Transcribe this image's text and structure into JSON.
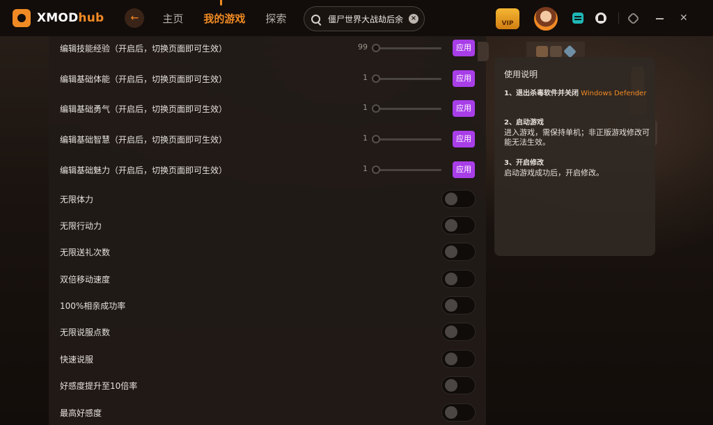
{
  "app": {
    "logo_text": "XMOD",
    "logo_accent": "hub"
  },
  "nav": {
    "items": [
      "主页",
      "我的游戏",
      "探索"
    ],
    "active_index": 1
  },
  "search": {
    "value": "僵尸世界大战劫后余"
  },
  "vip_label": "VIP",
  "sliders": [
    {
      "label": "编辑技能经验（开启后，切换页面即可生效）",
      "value": "99",
      "button": "应用"
    },
    {
      "label": "编辑基础体能（开启后，切换页面即可生效）",
      "value": "1",
      "button": "应用"
    },
    {
      "label": "编辑基础勇气（开启后，切换页面即可生效）",
      "value": "1",
      "button": "应用"
    },
    {
      "label": "编辑基础智慧（开启后，切换页面即可生效）",
      "value": "1",
      "button": "应用"
    },
    {
      "label": "编辑基础魅力（开启后，切换页面即可生效）",
      "value": "1",
      "button": "应用"
    }
  ],
  "toggles": [
    {
      "label": "无限体力",
      "on": false
    },
    {
      "label": "无限行动力",
      "on": false
    },
    {
      "label": "无限送礼次数",
      "on": false
    },
    {
      "label": "双倍移动速度",
      "on": false
    },
    {
      "label": "100%相亲成功率",
      "on": false
    },
    {
      "label": "无限说服点数",
      "on": false
    },
    {
      "label": "快速说服",
      "on": false
    },
    {
      "label": "好感度提升至10倍率",
      "on": false
    },
    {
      "label": "最高好感度",
      "on": false
    }
  ],
  "info": {
    "title": "使用说明",
    "step1_head": "1、退出杀毒软件并关闭",
    "step1_highlight": "Windows Defender",
    "step2_head": "2、启动游戏",
    "step2_body": "进入游戏，需保持单机；非正版游戏修改可能无法生效。",
    "step3_head": "3、开启修改",
    "step3_body": "启动游戏成功后，开启修改。"
  },
  "colors": {
    "accent": "#f08a24",
    "apply_button": "#a83ee8"
  }
}
